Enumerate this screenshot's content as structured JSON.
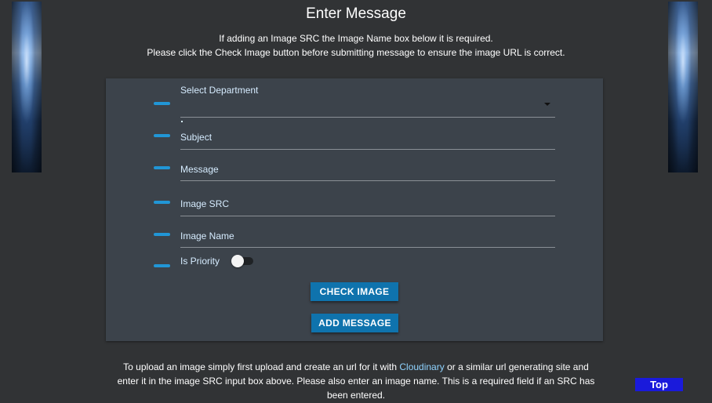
{
  "header": {
    "title": "Enter Message",
    "info_line_1": "If adding an Image SRC the Image Name box below it is required.",
    "info_line_2": "Please click the Check Image button before submitting message to ensure the image URL is correct."
  },
  "form": {
    "department_label": "Select Department",
    "department_value": "",
    "subject_label": "Subject",
    "message_label": "Message",
    "image_src_label": "Image SRC",
    "image_name_label": "Image Name",
    "priority_label": "Is Priority",
    "priority_on": false
  },
  "buttons": {
    "check_image": "CHECK IMAGE",
    "add_message": "ADD MESSAGE"
  },
  "footer": {
    "text_before_link": "To upload an image simply first upload and create an url for it with ",
    "link_text": "Cloudinary",
    "text_after_link": " or a similar url generating site and enter it in the image SRC input box above. Please also enter an image name. This is a required field if an SRC has been entered.",
    "top_button": "Top"
  },
  "colors": {
    "background": "#313335",
    "card": "#3c434b",
    "accent": "#2196d6",
    "button": "#0f73ad",
    "top_button": "#1a1adb",
    "label": "#d6ecff"
  }
}
